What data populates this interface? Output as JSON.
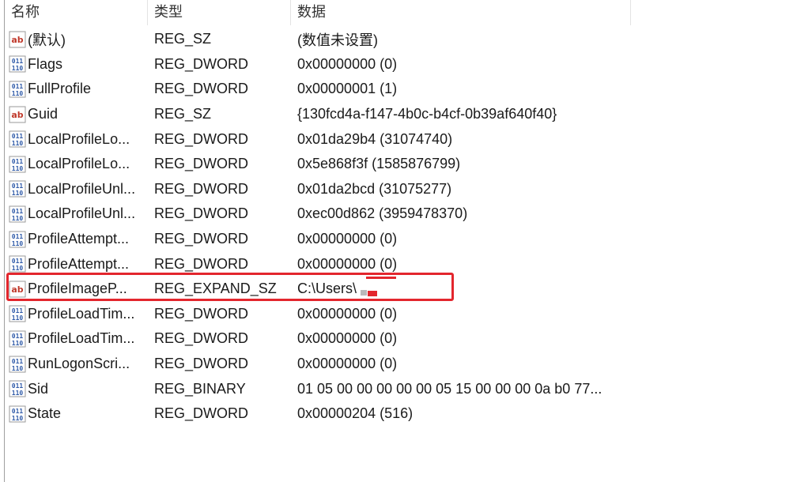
{
  "columns": {
    "name": "名称",
    "type": "类型",
    "data": "数据"
  },
  "rows": [
    {
      "name": "(默认)",
      "type": "REG_SZ",
      "data": "(数值未设置)",
      "icon": "ab"
    },
    {
      "name": "Flags",
      "type": "REG_DWORD",
      "data": "0x00000000 (0)",
      "icon": "bin"
    },
    {
      "name": "FullProfile",
      "type": "REG_DWORD",
      "data": "0x00000001 (1)",
      "icon": "bin"
    },
    {
      "name": "Guid",
      "type": "REG_SZ",
      "data": "{130fcd4a-f147-4b0c-b4cf-0b39af640f40}",
      "icon": "ab"
    },
    {
      "name": "LocalProfileLo...",
      "type": "REG_DWORD",
      "data": "0x01da29b4 (31074740)",
      "icon": "bin"
    },
    {
      "name": "LocalProfileLo...",
      "type": "REG_DWORD",
      "data": "0x5e868f3f (1585876799)",
      "icon": "bin"
    },
    {
      "name": "LocalProfileUnl...",
      "type": "REG_DWORD",
      "data": "0x01da2bcd (31075277)",
      "icon": "bin"
    },
    {
      "name": "LocalProfileUnl...",
      "type": "REG_DWORD",
      "data": "0xec00d862 (3959478370)",
      "icon": "bin"
    },
    {
      "name": "ProfileAttempt...",
      "type": "REG_DWORD",
      "data": "0x00000000 (0)",
      "icon": "bin"
    },
    {
      "name": "ProfileAttempt...",
      "type": "REG_DWORD",
      "data": "0x00000000 (0)",
      "icon": "bin"
    },
    {
      "name": "ProfileImageP...",
      "type": "REG_EXPAND_SZ",
      "data": "C:\\Users\\",
      "icon": "ab"
    },
    {
      "name": "ProfileLoadTim...",
      "type": "REG_DWORD",
      "data": "0x00000000 (0)",
      "icon": "bin"
    },
    {
      "name": "ProfileLoadTim...",
      "type": "REG_DWORD",
      "data": "0x00000000 (0)",
      "icon": "bin"
    },
    {
      "name": "RunLogonScri...",
      "type": "REG_DWORD",
      "data": "0x00000000 (0)",
      "icon": "bin"
    },
    {
      "name": "Sid",
      "type": "REG_BINARY",
      "data": "01 05 00 00 00 00 00 05 15 00 00 00 0a b0 77...",
      "icon": "bin"
    },
    {
      "name": "State",
      "type": "REG_DWORD",
      "data": "0x00000204 (516)",
      "icon": "bin"
    }
  ],
  "colors": {
    "highlight": "#e3262d",
    "icon_ab": "#c0392b",
    "icon_bin": "#2f5aa8"
  }
}
